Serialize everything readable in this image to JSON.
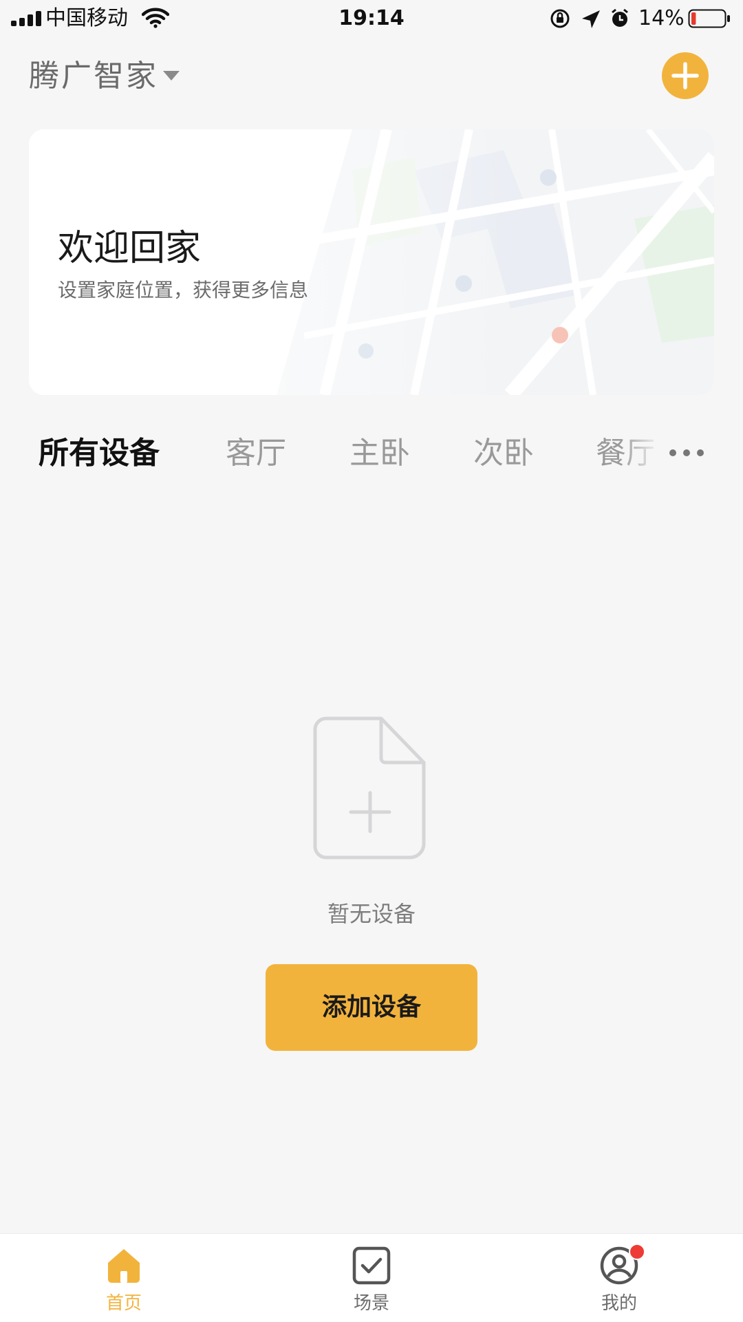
{
  "status_bar": {
    "carrier": "中国移动",
    "time": "19:14",
    "battery_percent": "14%",
    "battery_level": 0.14,
    "icons": [
      "signal-icon",
      "wifi-icon",
      "orientation-lock-icon",
      "location-icon",
      "alarm-icon",
      "battery-icon"
    ]
  },
  "header": {
    "home_name": "腾广智家",
    "dropdown_icon": "caret-down-icon",
    "add_icon": "plus-icon"
  },
  "welcome_card": {
    "title": "欢迎回家",
    "subtitle": "设置家庭位置，获得更多信息"
  },
  "room_tabs": {
    "items": [
      "所有设备",
      "客厅",
      "主卧",
      "次卧",
      "餐厅"
    ],
    "selected": "所有设备",
    "more_icon": "more-dots-icon"
  },
  "empty_state": {
    "icon": "add-file-icon",
    "message": "暂无设备",
    "button_label": "添加设备"
  },
  "bottom_nav": {
    "items": [
      {
        "label": "首页",
        "icon": "home-icon",
        "active": true
      },
      {
        "label": "场景",
        "icon": "checkbox-icon",
        "active": false
      },
      {
        "label": "我的",
        "icon": "user-icon",
        "active": false,
        "badge": true
      }
    ]
  },
  "colors": {
    "accent": "#f2b33d",
    "background": "#f6f6f6",
    "badge": "#ee3b35"
  }
}
